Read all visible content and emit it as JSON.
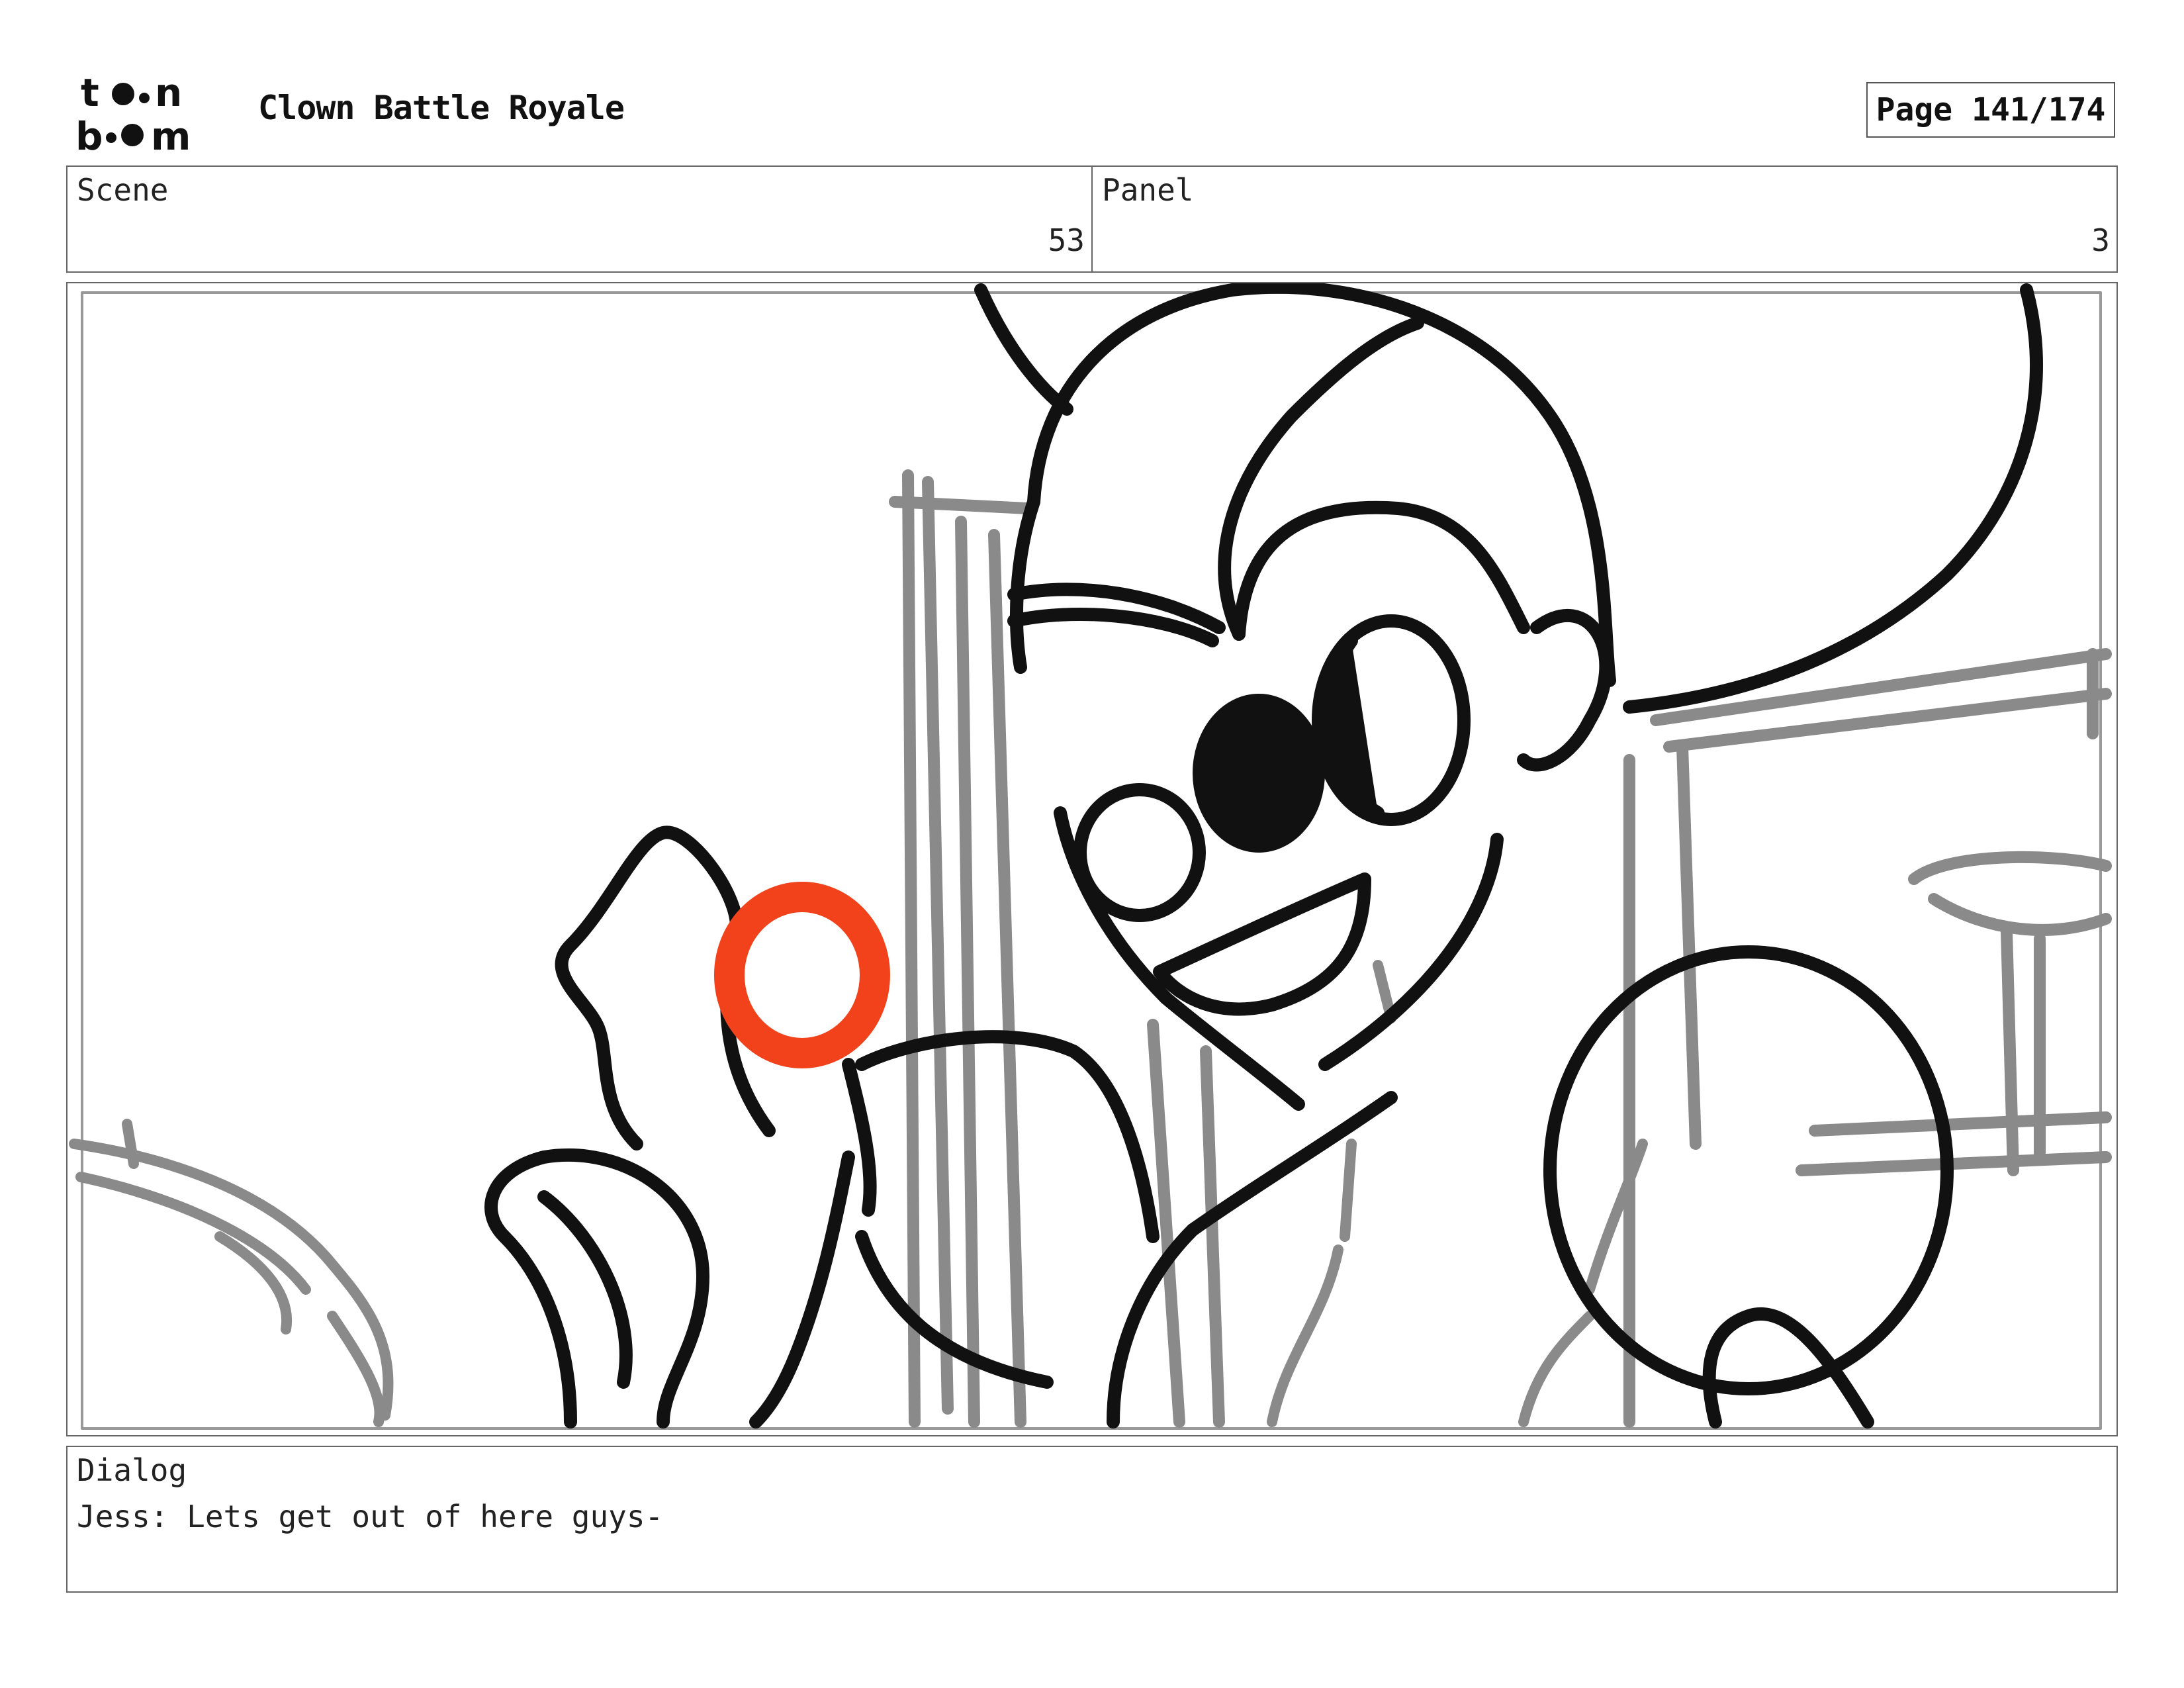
{
  "header": {
    "logo_text": "toon boom",
    "project_title": "Clown Battle Royale",
    "page_label": "Page 141/174"
  },
  "info": {
    "scene_label": "Scene",
    "scene_value": "53",
    "panel_label": "Panel",
    "panel_value": "3"
  },
  "dialog": {
    "label": "Dialog",
    "text": "Jess: Lets get out of here guys-"
  },
  "colors": {
    "ink": "#111111",
    "sketch_gray": "#8a8a8a",
    "clown_nose_red": "#f2421c"
  }
}
